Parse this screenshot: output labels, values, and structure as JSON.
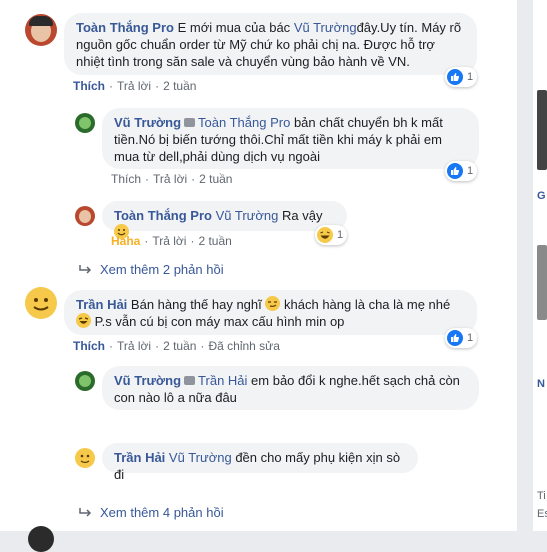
{
  "comments": [
    {
      "author": "Toàn Thắng Pro",
      "text": "E mới mua của bác",
      "mention": "Vũ Trường",
      "text2": "đây.Uy tín. Máy rõ nguồn gốc chuẩn order từ Mỹ chứ ko phải chị na. Được hỗ trợ nhiệt tình trong săn sale và chuyển vùng bảo hành về VN.",
      "actions": {
        "like": "Thích",
        "reply": "Trả lời",
        "time": "2 tuần"
      },
      "reaction_count": "1",
      "replies": [
        {
          "author": "Vũ Trường",
          "mention": "Toàn Thắng Pro",
          "text": "bản chất chuyển bh k mất tiền.Nó bị biến tướng thôi.Chỉ mất tiền khi máy k phải em mua từ dell,phải dùng dịch vụ ngoài",
          "actions": {
            "like": "Thích",
            "reply": "Trả lời",
            "time": "2 tuần"
          },
          "reaction_count": "1"
        },
        {
          "author": "Toàn Thắng Pro",
          "mention": "Vũ Trường",
          "text": "Ra vậy",
          "actions": {
            "like": "Haha",
            "reply": "Trả lời",
            "time": "2 tuần"
          },
          "reaction_count": "1"
        }
      ],
      "more_replies": "Xem thêm 2 phản hồi"
    },
    {
      "author": "Trần Hải",
      "text": "Bán hàng thế hay nghĩ",
      "text2": "khách hàng là cha là mẹ nhé",
      "text3": "P.s vẫn cú bị con máy max cấu hình min op",
      "actions": {
        "like": "Thích",
        "reply": "Trả lời",
        "time": "2 tuần",
        "edited": "Đã chỉnh sửa"
      },
      "reaction_count": "1",
      "replies": [
        {
          "author": "Vũ Trường",
          "mention": "Trần Hải",
          "text": "em bảo đổi k nghe.hết sạch chả còn con nào lô a nữa đâu"
        },
        {
          "author": "Trần Hải",
          "mention": "Vũ Trường",
          "text": "đền cho mấy phụ kiện xịn sò đi"
        }
      ],
      "more_replies": "Xem thêm 4 phản hồi"
    }
  ],
  "sidebar_fragments": [
    "G",
    "N",
    "Ti",
    "Es"
  ],
  "colors": {
    "link": "#385898",
    "bubble": "#f2f3f5",
    "like_blue": "#1877f2",
    "haha": "#f7b125"
  }
}
